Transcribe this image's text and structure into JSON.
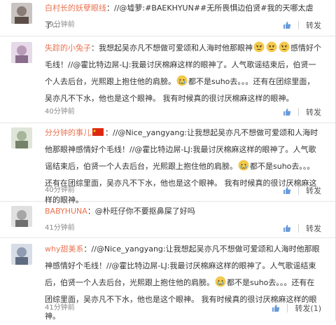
{
  "comments": [
    {
      "username": "白村长的妖孽眼线",
      "content": "：//@墟萝:#BAEKHYUN##无所畏惧边伯贤#我的天哪太虐了…",
      "time": "39分钟前",
      "repost_label": "转发"
    },
    {
      "username": "失踪的小兔子",
      "content_a": "：我想起吴亦凡不想做可爱颂和人海时他那眼神",
      "content_b": "感情好个毛线！//@霍比特边屌-LJ:我最讨厌棉麻这样的眼神了。人气歌谣结束后，伯贤一个人去后台，光熙跟上抱住他的肩膀。",
      "content_c": "都不是suho去。。。还有在团综里面，吴亦凡不下水，他也是这个眼神。 我有时候真的很讨厌棉麻这样的眼神。",
      "time": "40分钟前",
      "repost_label": "转发"
    },
    {
      "username": "分分钟的事儿",
      "content_a": "：//@Nice_yangyang:让我想起吴亦凡不想做可爱颂和人海时他那眼神感情好个毛线！//@霍比特边屌-LJ:我最讨厌棉麻这样的眼神了。人气歌谣结束后，伯贤一个人去后台，光熙跟上抱住他的肩膀。",
      "content_b": "都不是suho去。。。还有在团综里面，吴亦凡不下水，他也是这个眼神。 我有时候真的很讨厌棉麻这样的眼神。",
      "time": "40分钟前",
      "repost_label": "转发"
    },
    {
      "username": "BABYHUNA",
      "content": "：@朴旺仔你不要抠鼻屎了好吗",
      "time": "41分钟前",
      "repost_label": "转发"
    },
    {
      "username": "why甜美系",
      "content_a": "：//@Nice_yangyang:让我想起吴亦凡不想做可爱颂和人海时他那眼神感情好个毛线！//@霍比特边屌-LJ:我最讨厌棉麻这样的眼神了。人气歌谣结束后，伯贤一个人去后台，光熙跟上抱住他的肩膀。",
      "content_b": "都不是suho去。。。还有在团综里面，吴亦凡不下水，他也是这个眼神。 我有时候真的很讨厌棉麻这样的眼神。",
      "time": "41分钟前",
      "repost_label": "转发(1)"
    }
  ],
  "icons": {
    "like": "thumbs-up-icon",
    "emoji_angry": "angry-face-icon",
    "emoji_cry": "crying-face-icon",
    "flag": "china-flag-icon"
  },
  "colors": {
    "username": "#eb7350",
    "time": "#888888",
    "like": "#6a9bd8"
  }
}
